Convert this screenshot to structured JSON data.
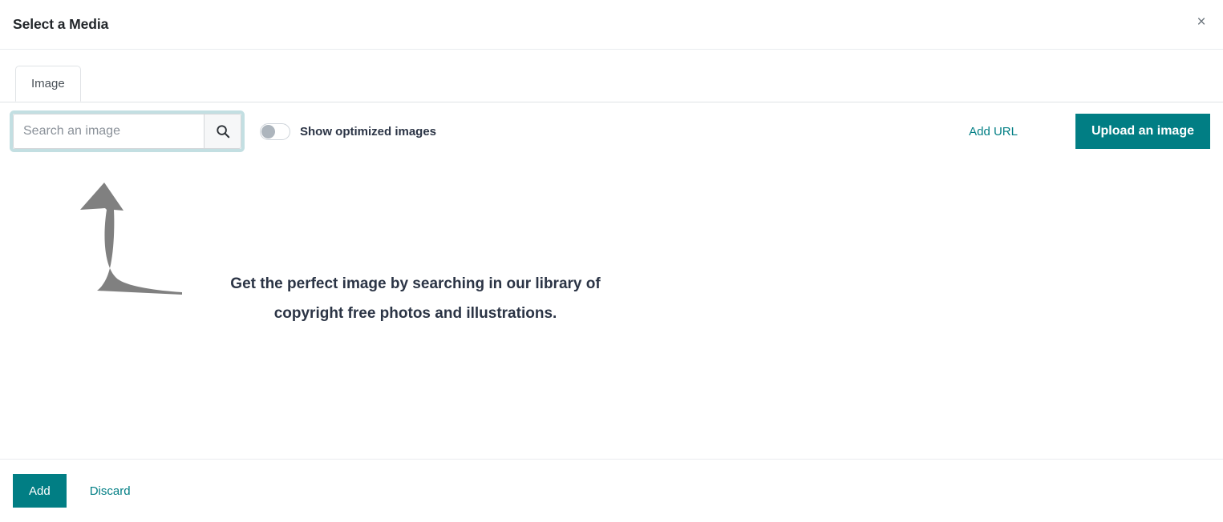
{
  "dialog": {
    "title": "Select a Media",
    "close_icon": "close-icon",
    "close_label": "×"
  },
  "tabs": [
    {
      "label": "Image",
      "active": true
    }
  ],
  "toolbar": {
    "search": {
      "placeholder": "Search an image",
      "value": "",
      "button_icon": "search-icon"
    },
    "optimized_toggle": {
      "label": "Show optimized images",
      "state": "off"
    },
    "add_url_label": "Add URL",
    "upload_label": "Upload an image"
  },
  "empty_state": {
    "arrow_icon": "curved-up-arrow-icon",
    "line1": "Get the perfect image by searching in our library of",
    "line2": "copyright free photos and illustrations."
  },
  "footer": {
    "add_label": "Add",
    "discard_label": "Discard"
  },
  "colors": {
    "accent_teal": "#017e84",
    "focus_ring": "#c3dfe2",
    "text_dark": "#2b3445",
    "muted_gray": "#808080",
    "border": "#e9ecef"
  }
}
